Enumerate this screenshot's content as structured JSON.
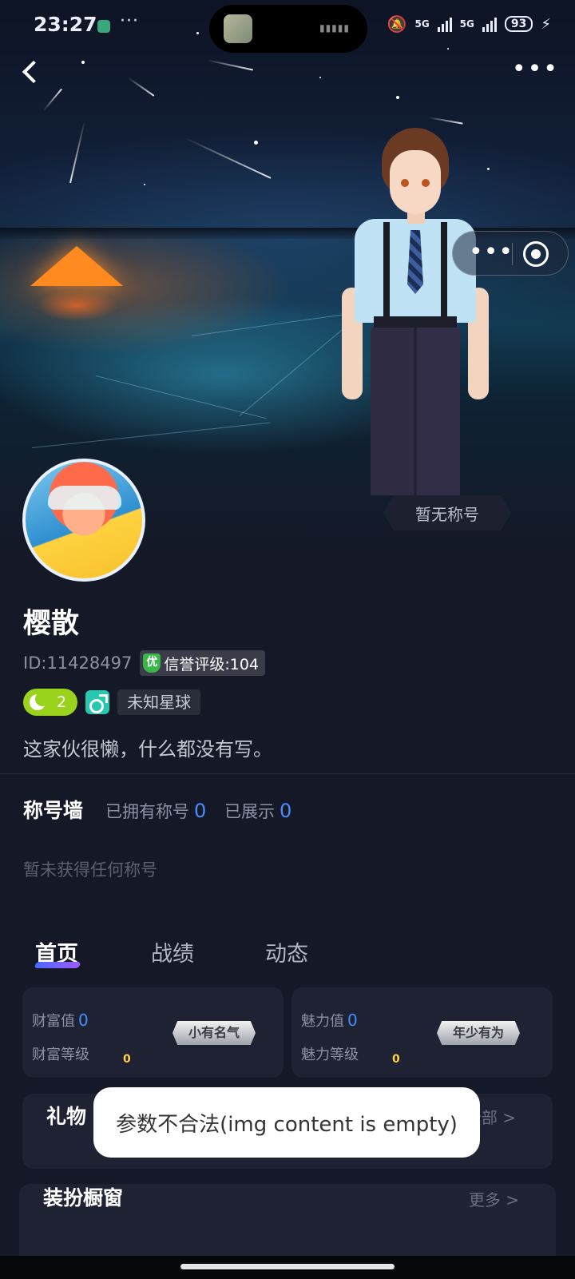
{
  "status_bar": {
    "time": "23:27",
    "more": "···",
    "network_1": "5G",
    "network_2": "5G",
    "battery": "93"
  },
  "nav": {
    "more": "•••"
  },
  "capsule": {
    "more": "•••"
  },
  "profile": {
    "title_badge": "暂无称号",
    "name": "樱散",
    "id": "ID:11428497",
    "credit_mark": "优",
    "credit": "信誉评级:104",
    "level": "2",
    "planet": "未知星球",
    "bio": "这家伙很懒，什么都没有写。"
  },
  "title_wall": {
    "title": "称号墙",
    "owned_label": "已拥有称号",
    "owned_count": "0",
    "shown_label": "已展示",
    "shown_count": "0",
    "empty_text": "暂未获得任何称号"
  },
  "tabs": [
    {
      "label": "首页",
      "active": true
    },
    {
      "label": "战绩",
      "active": false
    },
    {
      "label": "动态",
      "active": false
    }
  ],
  "wealth": {
    "value_label": "财富值",
    "value": "0",
    "level_label": "财富等级",
    "coin": "0",
    "medal": "小有名气"
  },
  "charm": {
    "value_label": "魅力值",
    "value": "0",
    "level_label": "魅力等级",
    "coin": "0",
    "medal": "年少有为"
  },
  "gifts": {
    "title": "礼物",
    "all": "全部 >"
  },
  "dress": {
    "title": "装扮橱窗",
    "more": "更多 >"
  },
  "toast": "参数不合法(img content is empty)",
  "colors": {
    "accent_blue": "#4a8cff",
    "level_green": "#9bd31c",
    "gender_teal": "#28c7b0",
    "page_bg": "#151826"
  }
}
